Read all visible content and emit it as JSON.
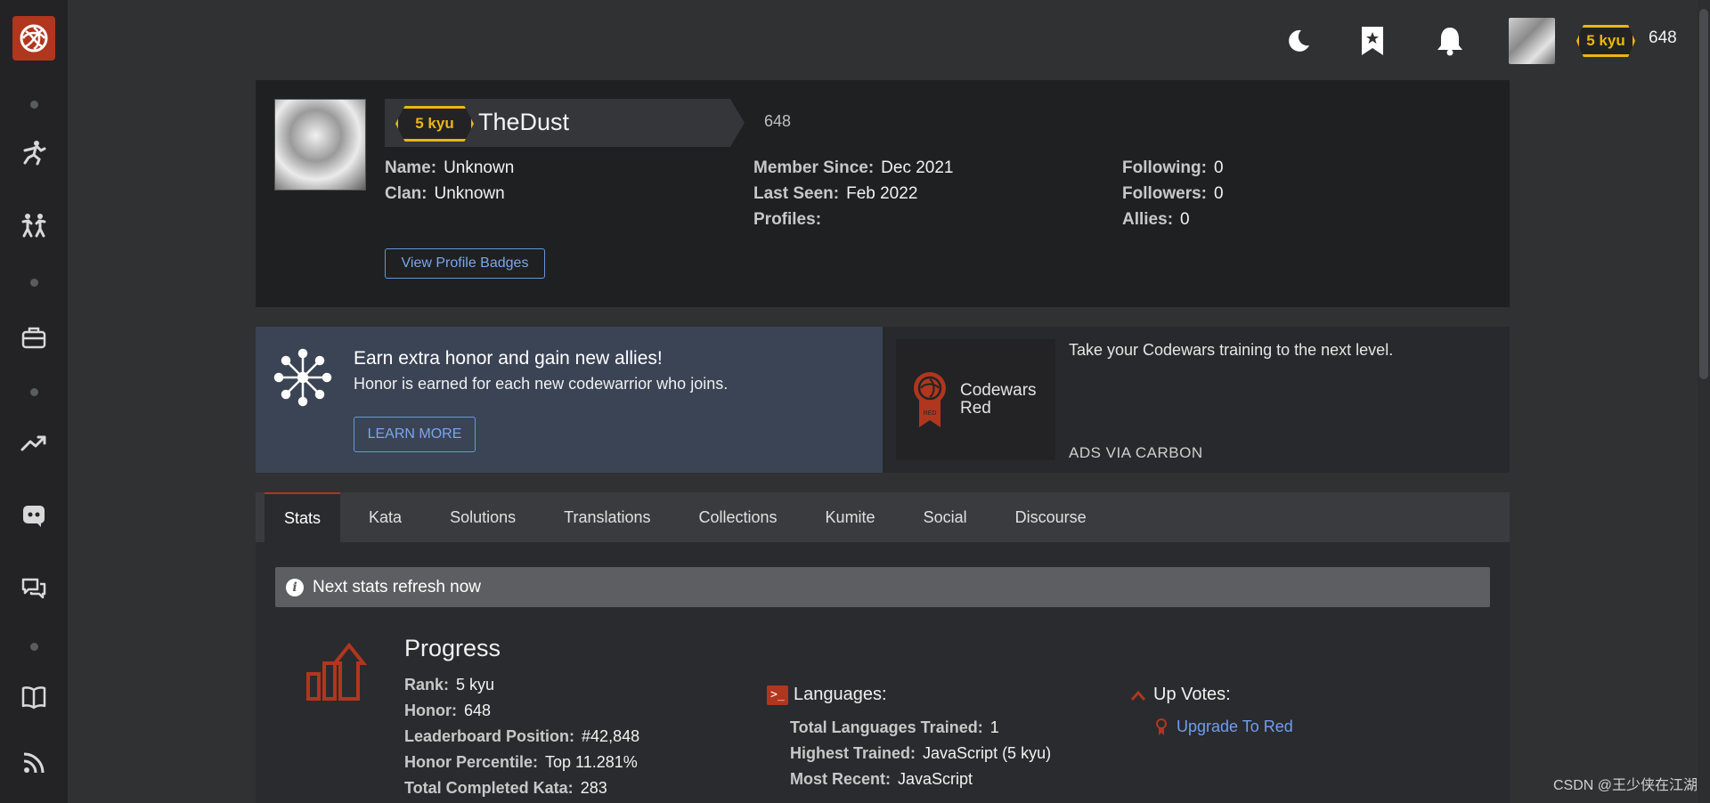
{
  "topbar": {
    "rank": "5 kyu",
    "honor": "648"
  },
  "profile": {
    "rank": "5 kyu",
    "username": "TheDust",
    "honor": "648",
    "name_label": "Name:",
    "name_value": "Unknown",
    "clan_label": "Clan:",
    "clan_value": "Unknown",
    "member_since_label": "Member Since:",
    "member_since_value": "Dec 2021",
    "last_seen_label": "Last Seen:",
    "last_seen_value": "Feb 2022",
    "profiles_label": "Profiles:",
    "following_label": "Following:",
    "following_value": "0",
    "followers_label": "Followers:",
    "followers_value": "0",
    "allies_label": "Allies:",
    "allies_value": "0",
    "badges_button": "View Profile Badges"
  },
  "referral": {
    "title": "Earn extra honor and gain new allies!",
    "subtitle": "Honor is earned for each new codewarrior who joins.",
    "button": "LEARN MORE"
  },
  "ad": {
    "image_text_line1": "Codewars",
    "image_text_line2": "Red",
    "medal_text": "RED",
    "text": "Take your Codewars training to the next level.",
    "via": "ADS VIA CARBON"
  },
  "tabs": [
    "Stats",
    "Kata",
    "Solutions",
    "Translations",
    "Collections",
    "Kumite",
    "Social",
    "Discourse"
  ],
  "stats": {
    "notice": "Next stats refresh now",
    "progress_title": "Progress",
    "rank_label": "Rank:",
    "rank_value": "5 kyu",
    "honor_label": "Honor:",
    "honor_value": "648",
    "leaderboard_label": "Leaderboard Position:",
    "leaderboard_value": "#42,848",
    "percentile_label": "Honor Percentile:",
    "percentile_value": "Top 11.281%",
    "completed_label": "Total Completed Kata:",
    "completed_value": "283",
    "languages_title": "Languages:",
    "total_langs_label": "Total Languages Trained:",
    "total_langs_value": "1",
    "highest_label": "Highest Trained:",
    "highest_value": "JavaScript (5 kyu)",
    "recent_label": "Most Recent:",
    "recent_value": "JavaScript",
    "upvotes_title": "Up Votes:",
    "upgrade_link": "Upgrade To Red"
  },
  "watermark": "CSDN @王少侠在江湖",
  "colors": {
    "accent": "#b1361e",
    "rank_yellow": "#ecb613",
    "link_blue": "#6e9ff0"
  }
}
